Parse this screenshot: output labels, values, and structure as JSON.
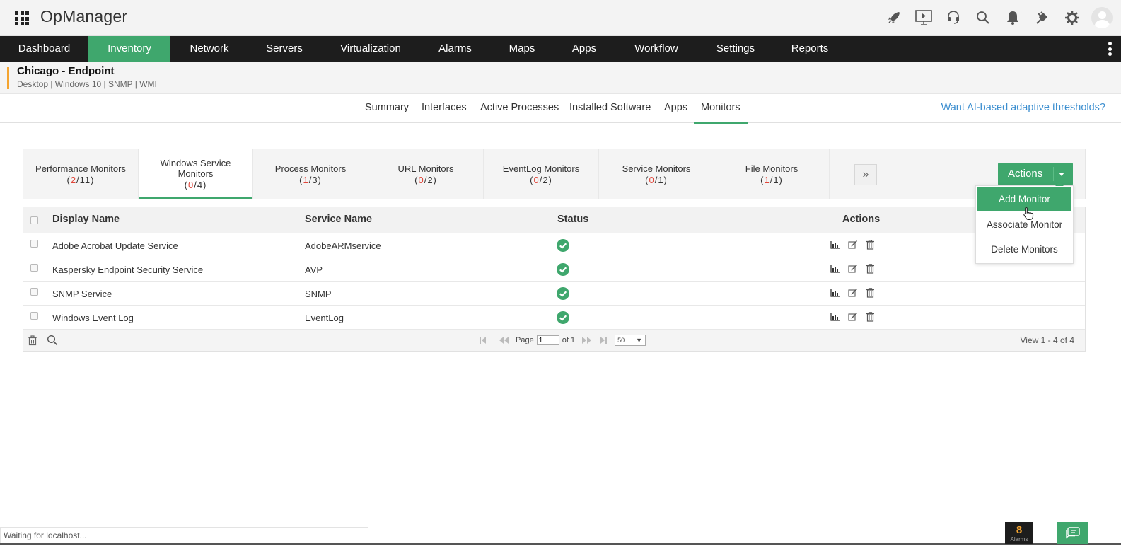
{
  "app": {
    "title": "OpManager"
  },
  "nav": {
    "items": [
      {
        "label": "Dashboard"
      },
      {
        "label": "Inventory"
      },
      {
        "label": "Network"
      },
      {
        "label": "Servers"
      },
      {
        "label": "Virtualization"
      },
      {
        "label": "Alarms"
      },
      {
        "label": "Maps"
      },
      {
        "label": "Apps"
      },
      {
        "label": "Workflow"
      },
      {
        "label": "Settings"
      },
      {
        "label": "Reports"
      }
    ],
    "active": "Inventory"
  },
  "device": {
    "name": "Chicago - Endpoint",
    "meta": "Desktop | Windows 10  | SNMP  | WMI"
  },
  "subtabs": {
    "items": [
      {
        "label": "Summary"
      },
      {
        "label": "Interfaces"
      },
      {
        "label": "Active Processes"
      },
      {
        "label": "Installed Software"
      },
      {
        "label": "Apps"
      },
      {
        "label": "Monitors"
      }
    ],
    "active": "Monitors",
    "ai_link": "Want AI-based adaptive thresholds?"
  },
  "monitor_tabs": [
    {
      "label": "Performance Monitors",
      "down": "2",
      "total": "11"
    },
    {
      "label": "Windows Service Monitors",
      "down": "0",
      "total": "4"
    },
    {
      "label": "Process Monitors",
      "down": "1",
      "total": "3"
    },
    {
      "label": "URL Monitors",
      "down": "0",
      "total": "2"
    },
    {
      "label": "EventLog Monitors",
      "down": "0",
      "total": "2"
    },
    {
      "label": "Service Monitors",
      "down": "0",
      "total": "1"
    },
    {
      "label": "File Monitors",
      "down": "1",
      "total": "1"
    }
  ],
  "monitor_tab_active": "Windows Service Monitors",
  "more_label": "»",
  "actions": {
    "label": "Actions",
    "menu": [
      "Add Monitor",
      "Associate Monitor",
      "Delete Monitors"
    ],
    "highlighted": "Add Monitor"
  },
  "table": {
    "columns": [
      "Display Name",
      "Service Name",
      "Status",
      "Actions"
    ],
    "rows": [
      {
        "display_name": "Adobe Acrobat Update Service",
        "service_name": "AdobeARMservice",
        "status": "up"
      },
      {
        "display_name": "Kaspersky Endpoint Security Service",
        "service_name": "AVP",
        "status": "up"
      },
      {
        "display_name": "SNMP Service",
        "service_name": "SNMP",
        "status": "up"
      },
      {
        "display_name": "Windows Event Log",
        "service_name": "EventLog",
        "status": "up"
      }
    ],
    "pager": {
      "page_label": "Page",
      "page_value": "1",
      "of_label": "of 1",
      "page_size": "50"
    },
    "view_info": "View 1 - 4 of 4"
  },
  "status_bar": {
    "text": "Waiting for localhost..."
  },
  "alarms": {
    "count": "8",
    "label": "Alarms"
  },
  "colors": {
    "accent": "#3fa76d",
    "nav_bg": "#1d1d1d",
    "down_count": "#e0463a",
    "link": "#3d8fd0",
    "alarm_count": "#f4a430"
  }
}
